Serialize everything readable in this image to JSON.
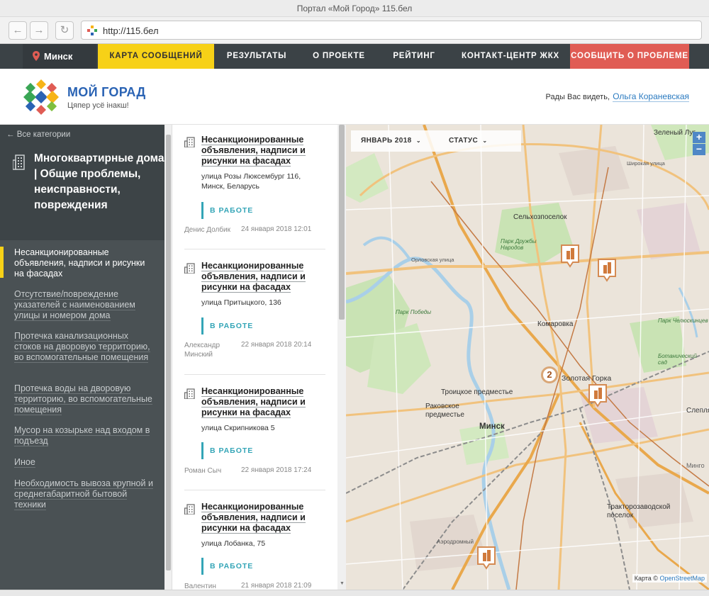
{
  "window": {
    "title": "Портал «Мой Город» 115.бел"
  },
  "browser": {
    "url": "http://115.бел",
    "back": "←",
    "forward": "→",
    "reload": "↻"
  },
  "nav": {
    "city": "Минск",
    "items": [
      {
        "label": "КАРТА СООБЩЕНИЙ",
        "active": true
      },
      {
        "label": "РЕЗУЛЬТАТЫ"
      },
      {
        "label": "О ПРОЕКТЕ"
      },
      {
        "label": "РЕЙТИНГ"
      },
      {
        "label": "КОНТАКТ-ЦЕНТР ЖКХ"
      },
      {
        "label": "СООБЩИТЬ О ПРОБЛЕМЕ"
      }
    ],
    "colors": {
      "active": "#f7d117",
      "report": "#e05c54",
      "bar": "#3b4246"
    }
  },
  "header": {
    "brand": "МОЙ ГОРАД",
    "slogan": "Цяпер усё інакш!",
    "greeting": "Рады Вас видеть,",
    "user": "Ольга Кораневская"
  },
  "sidebar": {
    "back": "← Все категории",
    "category_title": "Многоквартирные дома | Общие проблемы, неисправности, повреждения",
    "items": [
      {
        "label": "Несанкционированные объявления, надписи и рисунки на фасадах",
        "active": true
      },
      {
        "label": "Отсутствие/повреждение указателей с наименованием улицы и номером дома"
      },
      {
        "label": "Протечка канализационных стоков на дворовую территорию, во вспомогательные помещения"
      },
      {
        "label": "Протечка воды на дворовую территорию, во вспомогательные помещения"
      },
      {
        "label": "Мусор на козырьке над входом в подъезд"
      },
      {
        "label": "Иное"
      },
      {
        "label": "Необходимость вывоза крупной и среднегабаритной бытовой техники"
      }
    ]
  },
  "feed": {
    "items": [
      {
        "title": "Несанкционированные объявления, надписи и рисунки на фасадах",
        "address": "улица Розы Люксембург 116, Минск, Беларусь",
        "status": "В РАБОТЕ",
        "author": "Денис Долбик",
        "date": "24 января 2018 12:01"
      },
      {
        "title": "Несанкционированные объявления, надписи и рисунки на фасадах",
        "address": "улица Притыцкого, 136",
        "status": "В РАБОТЕ",
        "author": "Александр Минский",
        "date": "22 января 2018 20:14"
      },
      {
        "title": "Несанкционированные объявления, надписи и рисунки на фасадах",
        "address": "улица Скрипникова 5",
        "status": "В РАБОТЕ",
        "author": "Роман Сыч",
        "date": "22 января 2018 17:24"
      },
      {
        "title": "Несанкционированные объявления, надписи и рисунки на фасадах",
        "address": "улица Лобанка, 75",
        "status": "В РАБОТЕ",
        "author": "Валентин",
        "date": "21 января 2018 21:09"
      }
    ]
  },
  "map": {
    "filters": {
      "month": "ЯНВАРЬ 2018",
      "status": "СТАТУС"
    },
    "zoom_in": "+",
    "zoom_out": "−",
    "attribution_prefix": "Карта ©",
    "attribution_link": "OpenStreetMap",
    "cluster_count": "2",
    "labels": {
      "minsk": "Минск",
      "komarovka": "Комаровка",
      "selkhoz": "Сельхозпоселок",
      "zolotaya": "Золотая Горка",
      "troitskoe": "Троицкое предместье",
      "rakovskoe": "Раковское предместье",
      "traktor": "Тракторозаводской поселок",
      "zeleny": "Зеленый Луг",
      "park_pobedy": "Парк Победы",
      "park_druzhby": "Парк Дружбы Народов",
      "bot_sad": "Ботанический сад",
      "aerodromny": "Аэродромный",
      "orlovskaya": "Орловская улица",
      "shirokaya": "Широкая улица",
      "cheluskintsev": "Парк Челюскинцев",
      "mingo": "Минго",
      "sleplyanka": "Слепля"
    }
  }
}
